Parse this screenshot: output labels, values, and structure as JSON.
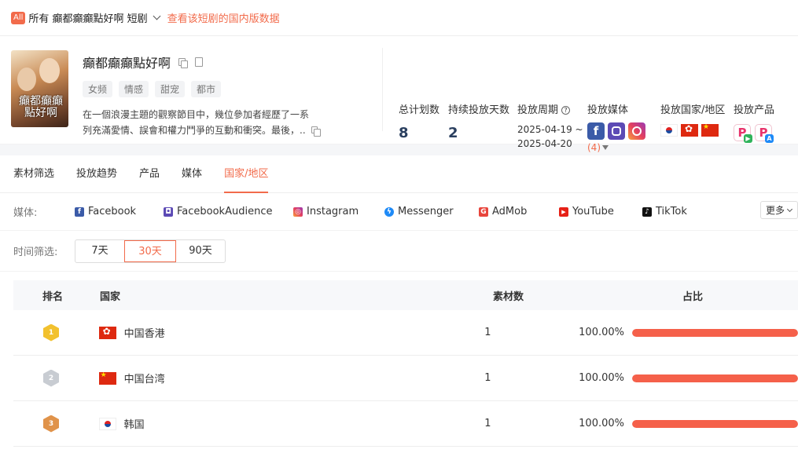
{
  "topbar": {
    "badge": "All",
    "title": "所有 癲都癲癲點好啊 短剧",
    "link": "查看该短剧的国内版数据"
  },
  "drama": {
    "poster_text": "癲都癲癲點好啊",
    "title": "癲都癲癲點好啊",
    "tags": [
      "女频",
      "情感",
      "甜宠",
      "都市"
    ],
    "desc_line1": "在一個浪漫主題的觀察節目中，幾位參加者經歷了一系",
    "desc_line2": "列充滿愛情、誤會和權力鬥爭的互動和衝突。最後，.."
  },
  "stats": {
    "plans_label": "总计划数",
    "plans_value": "8",
    "days_label": "持续投放天数",
    "days_value": "2",
    "period_label": "投放周期",
    "period_start": "2025-04-19 ~",
    "period_end": "2025-04-20",
    "media_label": "投放媒体",
    "media_icons": [
      "facebook-icon",
      "facebook-audience-icon",
      "instagram-icon"
    ],
    "media_more": "(4)",
    "countries_label": "投放国家/地区",
    "countries_flags": [
      "kr-flag",
      "hk-flag",
      "cn-flag"
    ],
    "products_label": "投放产品"
  },
  "tabs": [
    "素材筛选",
    "投放趋势",
    "产品",
    "媒体",
    "国家/地区"
  ],
  "active_tab": 4,
  "media_filter": {
    "label": "媒体:",
    "items": [
      {
        "name": "Facebook",
        "color": "#3b5ba8",
        "glyph": "f"
      },
      {
        "name": "FacebookAudience",
        "color": "#5c4ab5",
        "glyph": "◘"
      },
      {
        "name": "Instagram",
        "color": "#e4405f",
        "glyph": "◎"
      },
      {
        "name": "Messenger",
        "color": "#1e8af7",
        "glyph": "ϟ"
      },
      {
        "name": "AdMob",
        "color": "#e8453c",
        "glyph": "G"
      },
      {
        "name": "YouTube",
        "color": "#e62117",
        "glyph": "▶"
      },
      {
        "name": "TikTok",
        "color": "#111111",
        "glyph": "♪"
      }
    ],
    "more": "更多"
  },
  "time_filter": {
    "label": "时间筛选:",
    "options": [
      "7天",
      "30天",
      "90天"
    ],
    "active": 1
  },
  "table": {
    "headers": {
      "rank": "排名",
      "country": "国家",
      "count": "素材数",
      "ratio": "占比"
    },
    "rows": [
      {
        "rank": "1",
        "medal_color": "#f2c12e",
        "flag": "hk",
        "country": "中国香港",
        "count": "1",
        "pct": "100.00%",
        "fraction": 1.0
      },
      {
        "rank": "2",
        "medal_color": "#c8ccd2",
        "flag": "cn",
        "country": "中国台湾",
        "count": "1",
        "pct": "100.00%",
        "fraction": 1.0
      },
      {
        "rank": "3",
        "medal_color": "#e0934a",
        "flag": "kr",
        "country": "韩国",
        "count": "1",
        "pct": "100.00%",
        "fraction": 1.0
      }
    ]
  },
  "colors": {
    "accent": "#f26b4b",
    "bar": "#f5604a",
    "stat_value": "#2a3f5f"
  }
}
